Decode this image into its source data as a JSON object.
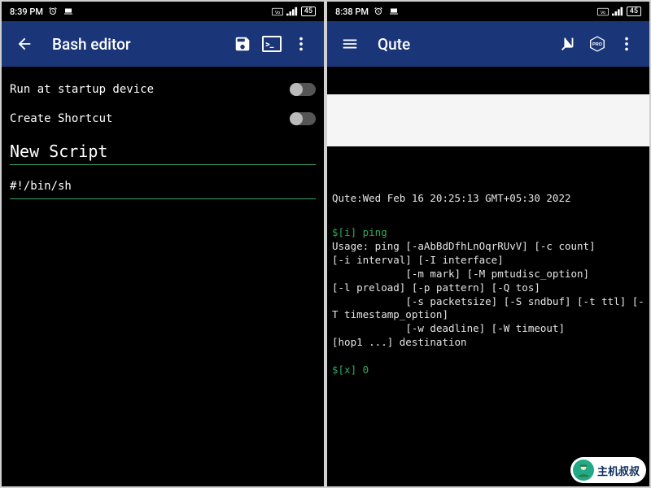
{
  "left": {
    "status": {
      "time": "8:39 PM",
      "battery": "45"
    },
    "appbar": {
      "title": "Bash editor"
    },
    "settings": {
      "run_at_startup": "Run at startup device",
      "create_shortcut": "Create Shortcut"
    },
    "script_name": "New Script",
    "script_body": "#!/bin/sh"
  },
  "right": {
    "status": {
      "time": "8:38 PM",
      "battery": "45"
    },
    "appbar": {
      "title": "Qute",
      "pro_label": "PRO"
    },
    "terminal": {
      "header": "Qute:Wed Feb 16 20:25:13 GMT+05:30 2022",
      "prompt1": "$[i] ping",
      "output": "Usage: ping [-aAbBdDfhLnOqrRUvV] [-c count]\n[-i interval] [-I interface]\n            [-m mark] [-M pmtudisc_option]\n[-l preload] [-p pattern] [-Q tos]\n            [-s packetsize] [-S sndbuf] [-t ttl] [-T timestamp_option]\n            [-w deadline] [-W timeout]\n[hop1 ...] destination",
      "prompt2": "$[x] 0"
    }
  },
  "watermark": "主机叔叔"
}
